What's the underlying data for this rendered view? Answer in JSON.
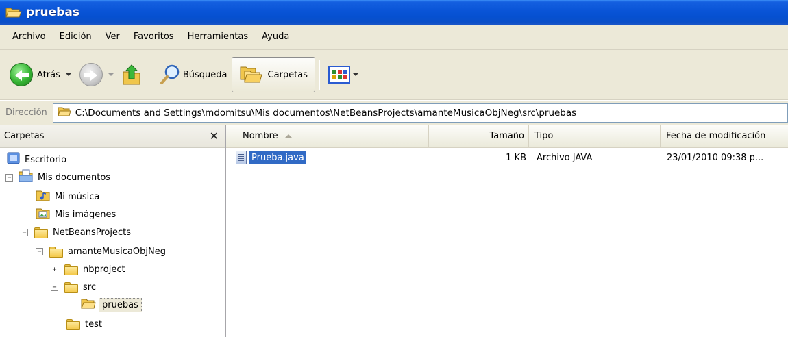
{
  "window": {
    "title": "pruebas"
  },
  "menu": [
    "Archivo",
    "Edición",
    "Ver",
    "Favoritos",
    "Herramientas",
    "Ayuda"
  ],
  "toolbar": {
    "back_label": "Atrás",
    "search_label": "Búsqueda",
    "folders_label": "Carpetas"
  },
  "address": {
    "label": "Dirección",
    "path": "C:\\Documents and Settings\\mdomitsu\\Mis documentos\\NetBeansProjects\\amanteMusicaObjNeg\\src\\pruebas"
  },
  "folders_pane": {
    "title": "Carpetas",
    "tree": [
      {
        "label": "Escritorio",
        "expander": "",
        "icon": "desktop-icon"
      },
      {
        "label": "Mis documentos",
        "expander": "−",
        "icon": "my-documents-icon"
      },
      {
        "label": "Mi música",
        "expander": "",
        "icon": "my-music-icon"
      },
      {
        "label": "Mis imágenes",
        "expander": "",
        "icon": "my-pictures-icon"
      },
      {
        "label": "NetBeansProjects",
        "expander": "−",
        "icon": "folder-icon"
      },
      {
        "label": "amanteMusicaObjNeg",
        "expander": "−",
        "icon": "folder-icon"
      },
      {
        "label": "nbproject",
        "expander": "+",
        "icon": "folder-icon"
      },
      {
        "label": "src",
        "expander": "−",
        "icon": "folder-icon"
      },
      {
        "label": "pruebas",
        "expander": "",
        "icon": "open-folder-icon",
        "selected": true
      },
      {
        "label": "test",
        "expander": "",
        "icon": "folder-icon"
      }
    ]
  },
  "file_list": {
    "columns": [
      "Nombre",
      "Tamaño",
      "Tipo",
      "Fecha de modificación"
    ],
    "rows": [
      {
        "name": "Prueba.java",
        "size": "1 KB",
        "type": "Archivo JAVA",
        "date": "23/01/2010 09:38 p..."
      }
    ]
  }
}
